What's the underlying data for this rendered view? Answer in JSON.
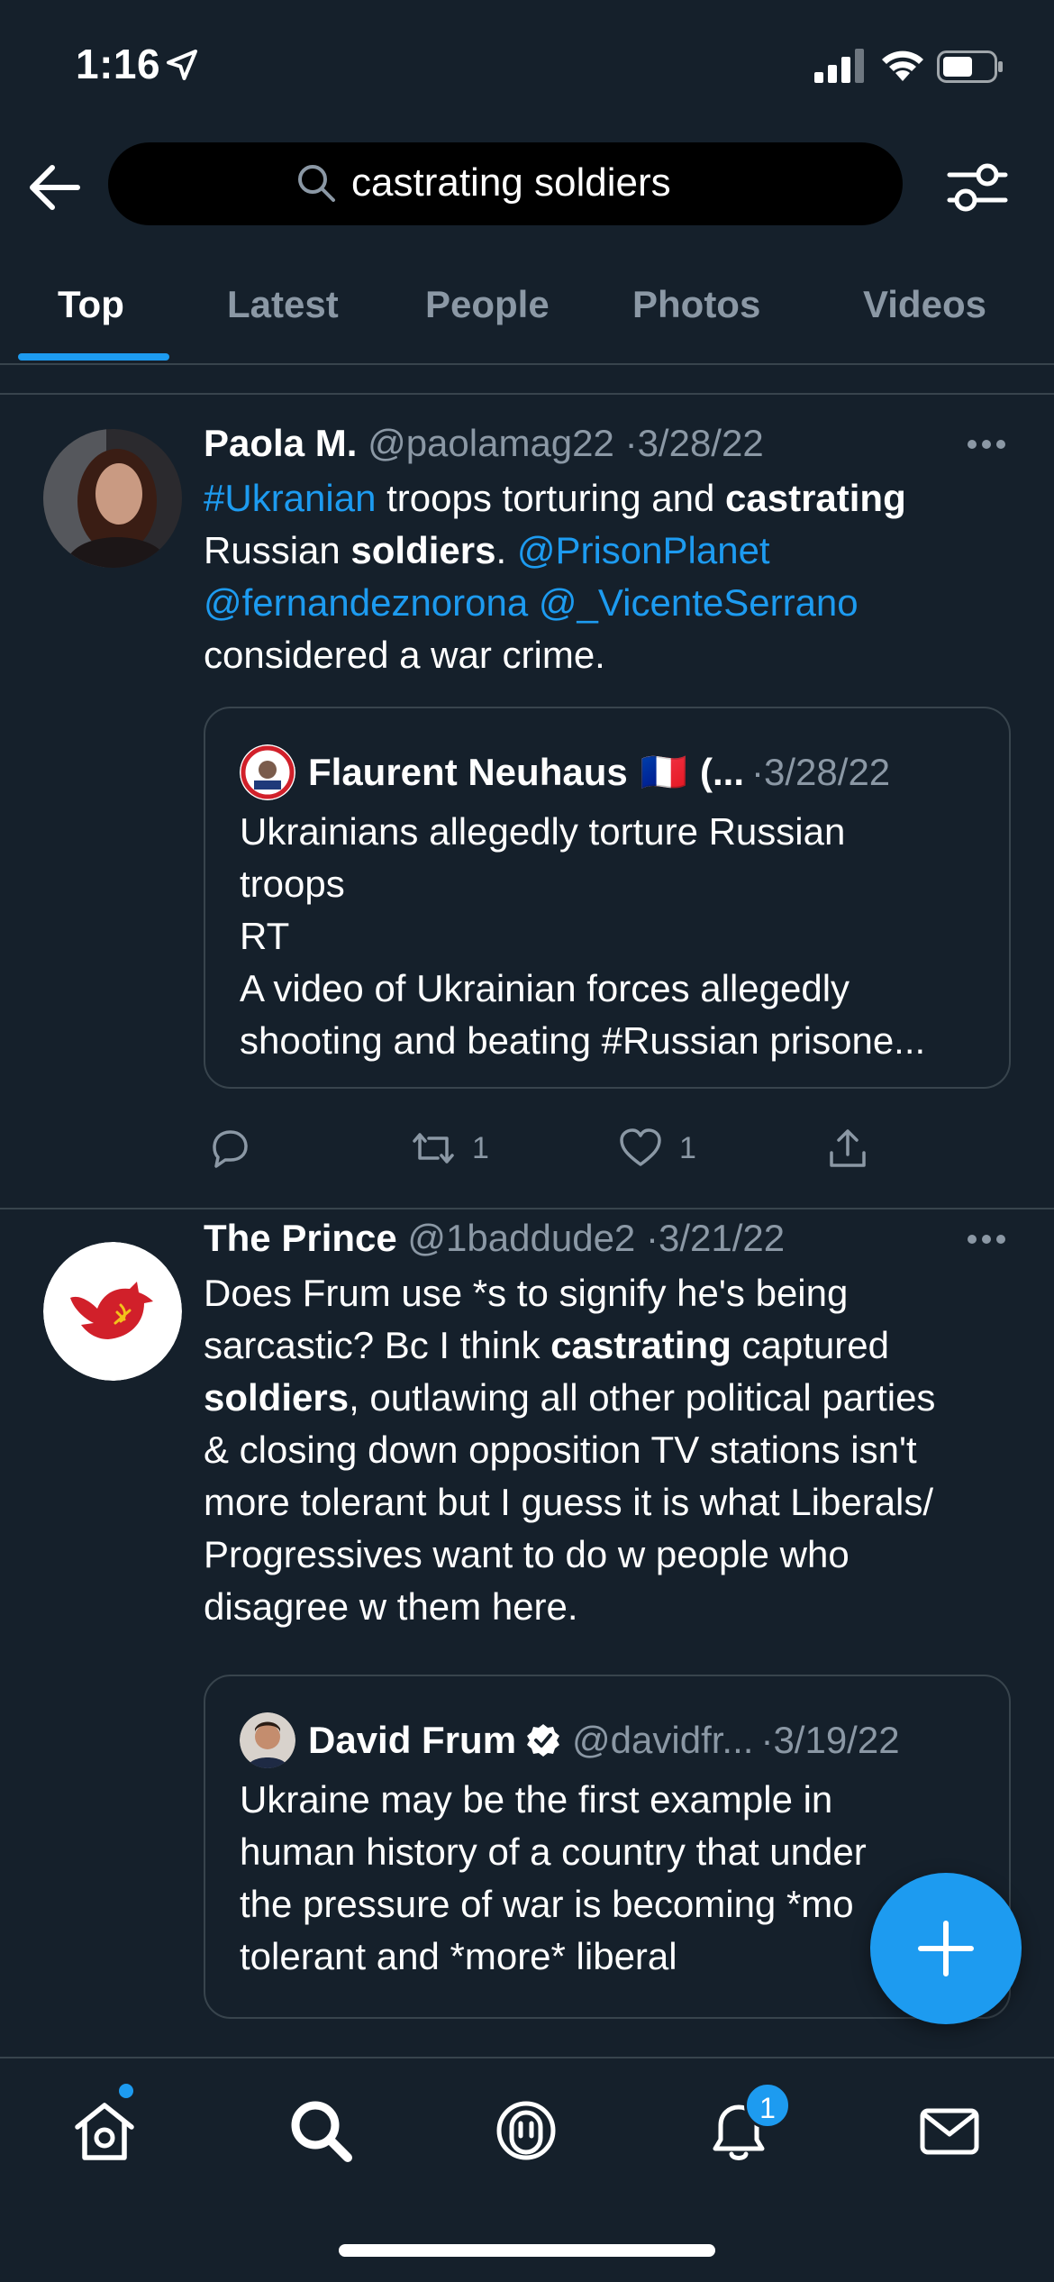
{
  "status": {
    "time": "1:16"
  },
  "search": {
    "query": "castrating soldiers"
  },
  "tabs": [
    {
      "label": "Top",
      "active": true
    },
    {
      "label": "Latest",
      "active": false
    },
    {
      "label": "People",
      "active": false
    },
    {
      "label": "Photos",
      "active": false
    },
    {
      "label": "Videos",
      "active": false
    }
  ],
  "tweets": [
    {
      "name": "Paola M.",
      "handle": "@paolamag22",
      "separator": "·",
      "date": "3/28/22",
      "body_lines": [
        [
          {
            "t": "#Ukranian",
            "s": "link"
          },
          {
            "t": " troops torturing and "
          },
          {
            "t": "castrating",
            "s": "bold"
          }
        ],
        [
          {
            "t": "Russian "
          },
          {
            "t": "soldiers",
            "s": "bold"
          },
          {
            "t": ". "
          },
          {
            "t": "@PrisonPlanet",
            "s": "link"
          }
        ],
        [
          {
            "t": "@fernandeznorona",
            "s": "link"
          },
          {
            "t": " "
          },
          {
            "t": "@_VicenteSerrano",
            "s": "link"
          }
        ],
        [
          {
            "t": "considered a war crime."
          }
        ]
      ],
      "quote": {
        "name": "Flaurent Neuhaus",
        "flag": "🇫🇷",
        "extra": "(...",
        "separator": "·",
        "date": "3/28/22",
        "lines": [
          "Ukrainians allegedly torture Russian",
          "troops",
          "RT",
          "A video of Ukrainian forces allegedly",
          "shooting and beating #Russian prisone..."
        ]
      },
      "actions": {
        "retweets": "1",
        "likes": "1"
      }
    },
    {
      "name": "The Prince",
      "handle": "@1baddude2",
      "separator": "·",
      "date": "3/21/22",
      "body_lines": [
        [
          {
            "t": "Does Frum use *s to signify he's being"
          }
        ],
        [
          {
            "t": "sarcastic? Bc I think "
          },
          {
            "t": "castrating",
            "s": "bold"
          },
          {
            "t": " captured"
          }
        ],
        [
          {
            "t": "soldiers",
            "s": "bold"
          },
          {
            "t": ", outlawing all other political parties"
          }
        ],
        [
          {
            "t": "& closing down opposition TV stations isn't"
          }
        ],
        [
          {
            "t": "more tolerant but I guess it is what Liberals/"
          }
        ],
        [
          {
            "t": "Progressives want to do w people who"
          }
        ],
        [
          {
            "t": "disagree w them here."
          }
        ]
      ],
      "quote": {
        "name": "David Frum",
        "handle": "@davidfr...",
        "separator": "·",
        "date": "3/19/22",
        "lines": [
          "Ukraine may be the first example in",
          "human history of a country that under",
          "the pressure of war is becoming *mo",
          "tolerant and *more* liberal"
        ]
      }
    }
  ],
  "nav": {
    "notifications_badge": "1"
  },
  "colors": {
    "background": "#15202b",
    "accent": "#1d9bf0",
    "muted": "#8b98a5",
    "divider": "#38444d"
  }
}
